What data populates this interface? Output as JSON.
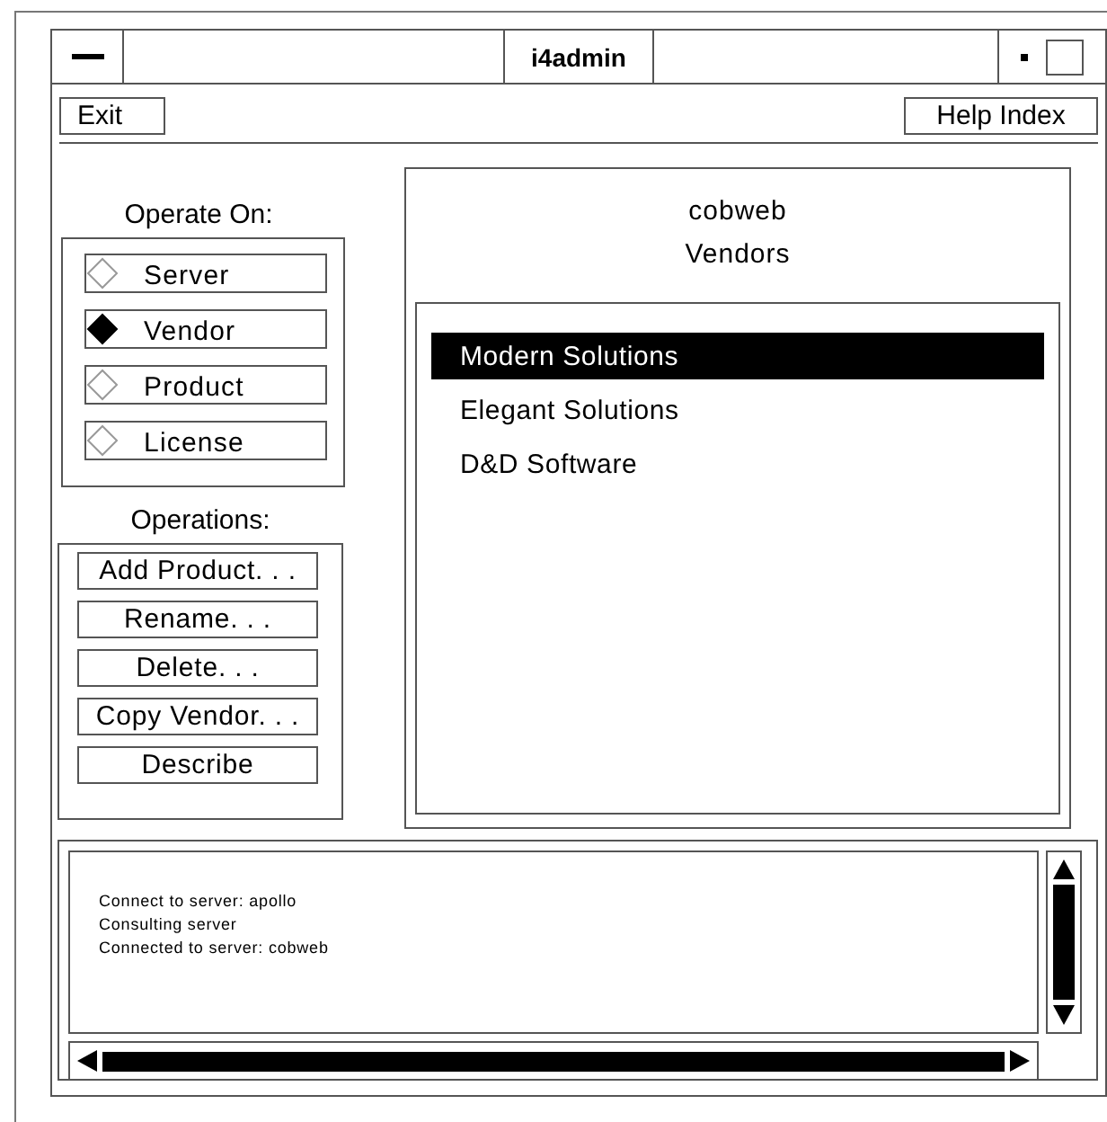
{
  "window": {
    "title": "i4admin"
  },
  "menu_bar": {
    "left_button": "Exit",
    "right_button": "Help Index"
  },
  "operate_on": {
    "label": "Operate On:",
    "items": [
      {
        "label": "Server",
        "selected": false
      },
      {
        "label": "Vendor",
        "selected": true
      },
      {
        "label": "Product",
        "selected": false
      },
      {
        "label": "License",
        "selected": false
      }
    ]
  },
  "operations": {
    "label": "Operations:",
    "buttons": [
      "Add Product. . .",
      "Rename. . .",
      "Delete. . .",
      "Copy Vendor. . .",
      "Describe"
    ]
  },
  "main_panel": {
    "server": "cobweb",
    "heading": "Vendors",
    "items": [
      {
        "label": "Modern Solutions",
        "selected": true
      },
      {
        "label": "Elegant Solutions",
        "selected": false
      },
      {
        "label": "D&D Software",
        "selected": false
      }
    ]
  },
  "log": {
    "lines": [
      "Connect to server: apollo",
      "Consulting server",
      "Connected to server: cobweb"
    ]
  }
}
